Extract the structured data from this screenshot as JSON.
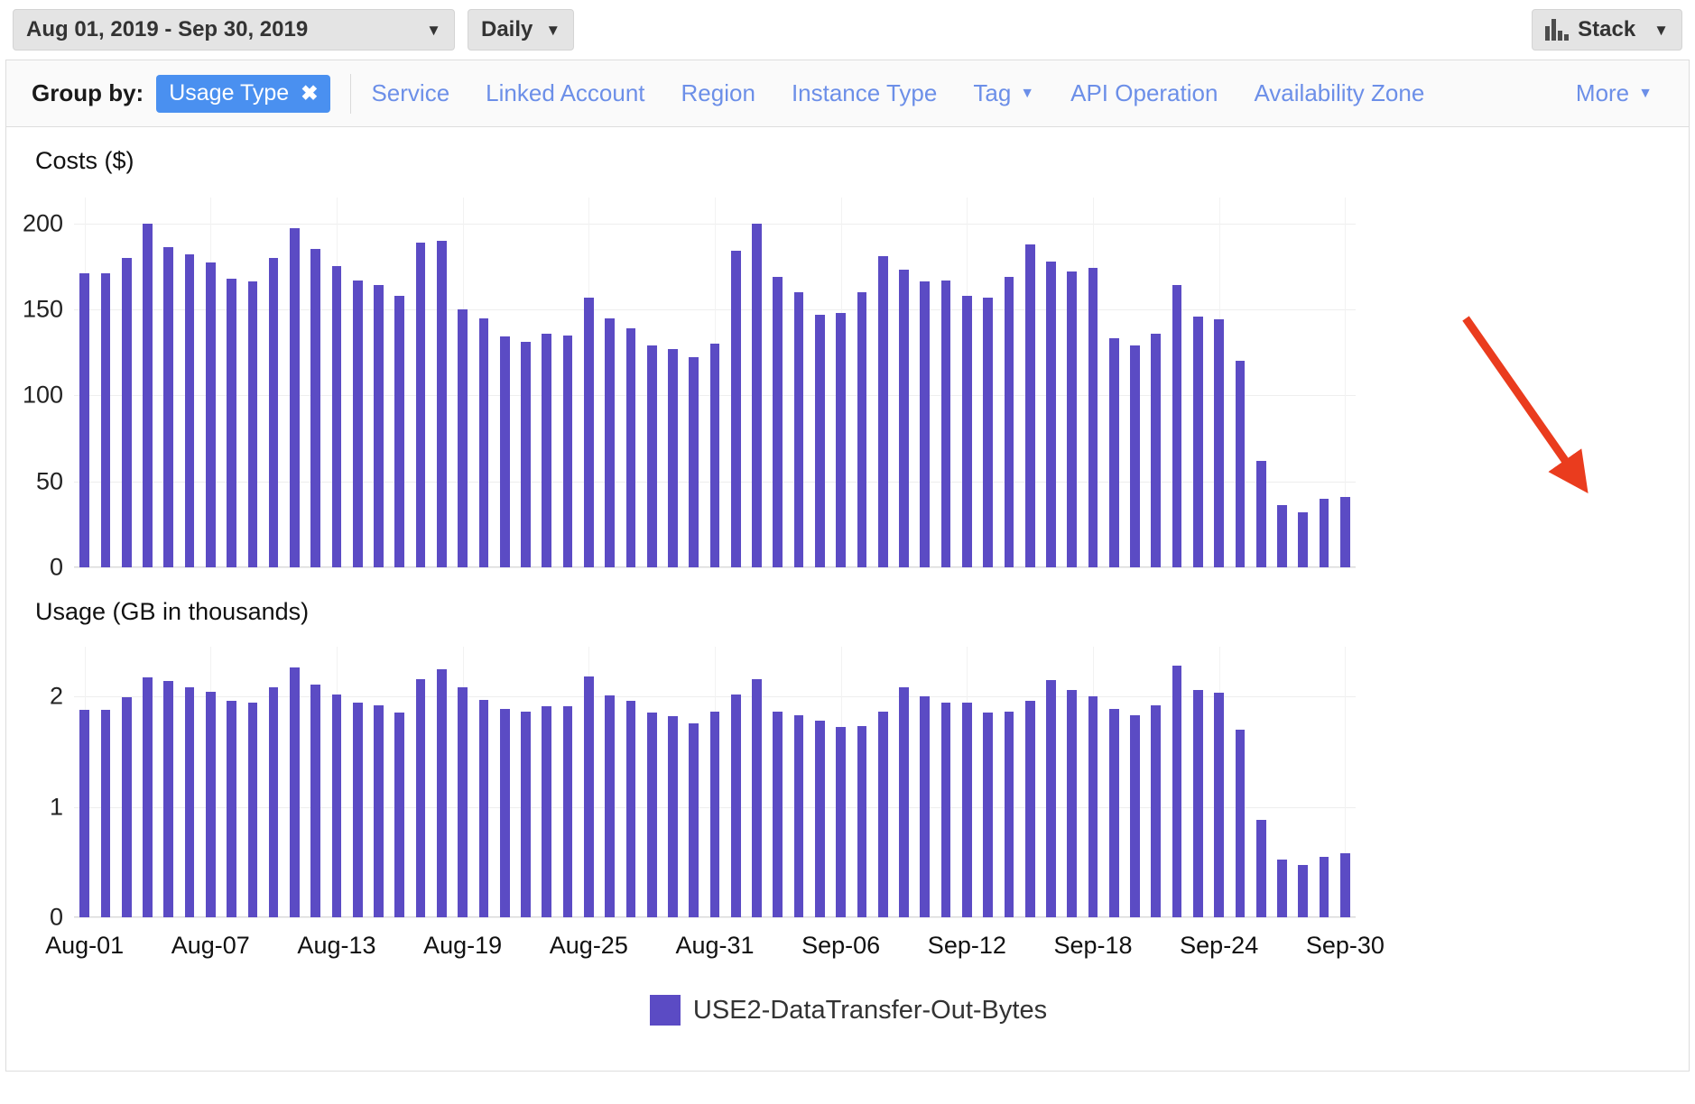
{
  "toolbar": {
    "date_range": "Aug 01, 2019 - Sep 30, 2019",
    "granularity": "Daily",
    "stack_label": "Stack",
    "caret": "▼"
  },
  "group_by": {
    "label": "Group by:",
    "selected_chip": "Usage Type",
    "chip_remove": "✖",
    "options": [
      {
        "label": "Service",
        "has_caret": false
      },
      {
        "label": "Linked Account",
        "has_caret": false
      },
      {
        "label": "Region",
        "has_caret": false
      },
      {
        "label": "Instance Type",
        "has_caret": false
      },
      {
        "label": "Tag",
        "has_caret": true
      },
      {
        "label": "API Operation",
        "has_caret": false
      },
      {
        "label": "Availability Zone",
        "has_caret": false
      }
    ],
    "more": "More",
    "caret": "▼"
  },
  "legend": {
    "series_label": "USE2-DataTransfer-Out-Bytes",
    "color": "#5b4bc4"
  },
  "annotation": {
    "type": "down-trend-arrow",
    "color": "#ea3c1e"
  },
  "chart_data": [
    {
      "type": "bar",
      "title": "Costs ($)",
      "xlabel": "",
      "ylabel": "Costs ($)",
      "ylim": [
        0,
        215
      ],
      "yticks": [
        0,
        50,
        100,
        150,
        200
      ],
      "grid": true,
      "legend_position": "bottom",
      "categories": [
        "Aug-01",
        "Aug-02",
        "Aug-03",
        "Aug-04",
        "Aug-05",
        "Aug-06",
        "Aug-07",
        "Aug-08",
        "Aug-09",
        "Aug-10",
        "Aug-11",
        "Aug-12",
        "Aug-13",
        "Aug-14",
        "Aug-15",
        "Aug-16",
        "Aug-17",
        "Aug-18",
        "Aug-19",
        "Aug-20",
        "Aug-21",
        "Aug-22",
        "Aug-23",
        "Aug-24",
        "Aug-25",
        "Aug-26",
        "Aug-27",
        "Aug-28",
        "Aug-29",
        "Aug-30",
        "Aug-31",
        "Sep-01",
        "Sep-02",
        "Sep-03",
        "Sep-04",
        "Sep-05",
        "Sep-06",
        "Sep-07",
        "Sep-08",
        "Sep-09",
        "Sep-10",
        "Sep-11",
        "Sep-12",
        "Sep-13",
        "Sep-14",
        "Sep-15",
        "Sep-16",
        "Sep-17",
        "Sep-18",
        "Sep-19",
        "Sep-20",
        "Sep-21",
        "Sep-22",
        "Sep-23",
        "Sep-24",
        "Sep-25",
        "Sep-26",
        "Sep-27",
        "Sep-28",
        "Sep-29",
        "Sep-30"
      ],
      "xtick_labels": [
        "Aug-01",
        "Aug-07",
        "Aug-13",
        "Aug-19",
        "Aug-25",
        "Aug-31",
        "Sep-06",
        "Sep-12",
        "Sep-18",
        "Sep-24",
        "Sep-30"
      ],
      "series": [
        {
          "name": "USE2-DataTransfer-Out-Bytes",
          "color": "#5b4bc4",
          "values": [
            171,
            171,
            180,
            200,
            186,
            182,
            177,
            168,
            166,
            180,
            197,
            185,
            175,
            167,
            164,
            158,
            189,
            190,
            150,
            145,
            134,
            131,
            136,
            135,
            157,
            145,
            139,
            129,
            127,
            122,
            130,
            184,
            200,
            169,
            160,
            147,
            148,
            160,
            181,
            173,
            166,
            167,
            158,
            157,
            169,
            188,
            178,
            172,
            174,
            133,
            129,
            136,
            164,
            146,
            144,
            120,
            62,
            36,
            32,
            40,
            41
          ]
        }
      ]
    },
    {
      "type": "bar",
      "title": "Usage (GB in thousands)",
      "xlabel": "",
      "ylabel": "Usage (GB in thousands)",
      "ylim": [
        0,
        2.45
      ],
      "yticks": [
        0,
        1,
        2
      ],
      "grid": true,
      "legend_position": "bottom",
      "categories": [
        "Aug-01",
        "Aug-02",
        "Aug-03",
        "Aug-04",
        "Aug-05",
        "Aug-06",
        "Aug-07",
        "Aug-08",
        "Aug-09",
        "Aug-10",
        "Aug-11",
        "Aug-12",
        "Aug-13",
        "Aug-14",
        "Aug-15",
        "Aug-16",
        "Aug-17",
        "Aug-18",
        "Aug-19",
        "Aug-20",
        "Aug-21",
        "Aug-22",
        "Aug-23",
        "Aug-24",
        "Aug-25",
        "Aug-26",
        "Aug-27",
        "Aug-28",
        "Aug-29",
        "Aug-30",
        "Aug-31",
        "Sep-01",
        "Sep-02",
        "Sep-03",
        "Sep-04",
        "Sep-05",
        "Sep-06",
        "Sep-07",
        "Sep-08",
        "Sep-09",
        "Sep-10",
        "Sep-11",
        "Sep-12",
        "Sep-13",
        "Sep-14",
        "Sep-15",
        "Sep-16",
        "Sep-17",
        "Sep-18",
        "Sep-19",
        "Sep-20",
        "Sep-21",
        "Sep-22",
        "Sep-23",
        "Sep-24",
        "Sep-25",
        "Sep-26",
        "Sep-27",
        "Sep-28",
        "Sep-29",
        "Sep-30"
      ],
      "xtick_labels": [
        "Aug-01",
        "Aug-07",
        "Aug-13",
        "Aug-19",
        "Aug-25",
        "Aug-31",
        "Sep-06",
        "Sep-12",
        "Sep-18",
        "Sep-24",
        "Sep-30"
      ],
      "series": [
        {
          "name": "USE2-DataTransfer-Out-Bytes",
          "color": "#5b4bc4",
          "values": [
            1.88,
            1.88,
            1.99,
            2.17,
            2.14,
            2.08,
            2.04,
            1.96,
            1.94,
            2.08,
            2.26,
            2.11,
            2.02,
            1.94,
            1.92,
            1.85,
            2.16,
            2.25,
            2.08,
            1.97,
            1.89,
            1.86,
            1.91,
            1.91,
            2.18,
            2.01,
            1.96,
            1.85,
            1.82,
            1.76,
            1.86,
            2.02,
            2.16,
            1.86,
            1.83,
            1.78,
            1.72,
            1.73,
            1.86,
            2.08,
            2.0,
            1.94,
            1.94,
            1.85,
            1.86,
            1.96,
            2.15,
            2.06,
            2.0,
            1.89,
            1.83,
            1.92,
            2.28,
            2.06,
            2.03,
            1.7,
            0.88,
            0.52,
            0.47,
            0.55,
            0.58
          ]
        }
      ]
    }
  ]
}
